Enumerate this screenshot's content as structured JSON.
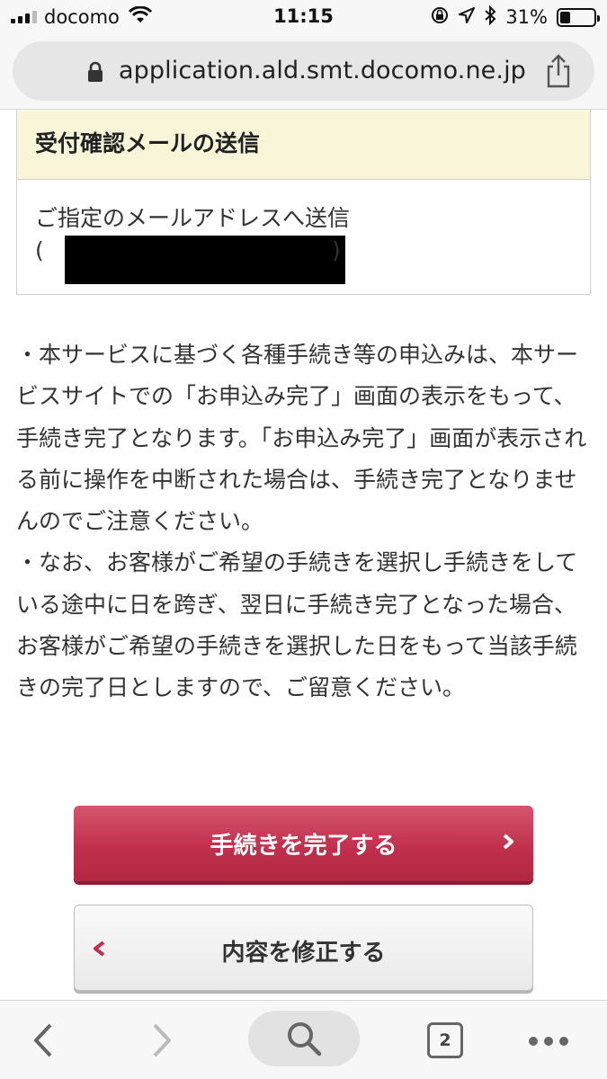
{
  "status_bar": {
    "carrier": "docomo",
    "time": "11:15",
    "battery_percent": "31%",
    "battery_level": 0.31,
    "icons": [
      "signal-icon",
      "wifi-icon",
      "orientation-lock-icon",
      "location-icon",
      "bluetooth-icon",
      "battery-icon"
    ]
  },
  "browser": {
    "url": "application.ald.smt.docomo.ne.jp",
    "tab_count": "2"
  },
  "confirmation_mail": {
    "heading": "受付確認メールの送信",
    "line1": "ご指定のメールアドレスへ送信",
    "paren_open": "(",
    "paren_close": ")"
  },
  "notes": {
    "note1": "・本サービスに基づく各種手続き等の申込みは、本サービスサイトでの「お申込み完了」画面の表示をもって、手続き完了となります。「お申込み完了」画面が表示される前に操作を中断された場合は、手続き完了となりませんのでご注意ください。",
    "note2": "・なお、お客様がご希望の手続きを選択し手続きをしている途中に日を跨ぎ、翌日に手続き完了となった場合、お客様がご希望の手続きを選択した日をもって当該手続きの完了日としますので、ご留意ください。"
  },
  "buttons": {
    "complete_label": "手続きを完了する",
    "modify_label": "内容を修正する"
  },
  "colors": {
    "primary_button": "#c1304d",
    "header_background": "#f8f5d9"
  }
}
